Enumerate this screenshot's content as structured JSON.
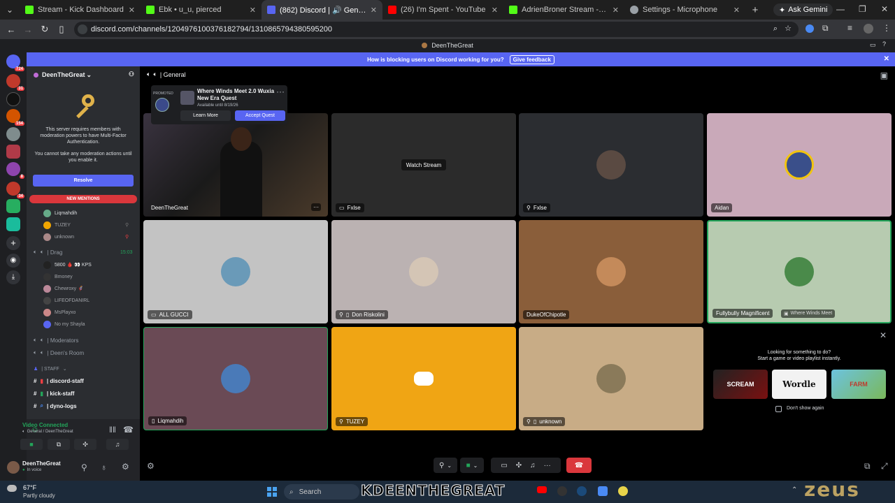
{
  "chrome": {
    "tabs": [
      {
        "label": "Stream - Kick Dashboard",
        "color": "#53fc18"
      },
      {
        "label": "Ebk • u_u, pierced",
        "color": "#53fc18"
      },
      {
        "label": "(862) Discord | 🔊 General",
        "color": "#5865f2",
        "active": true
      },
      {
        "label": "(26) I'm Spent - YouTube",
        "color": "#ff0000"
      },
      {
        "label": "AdrienBroner Stream - Watch L",
        "color": "#53fc18"
      },
      {
        "label": "Settings - Microphone",
        "color": "#9aa0a6"
      }
    ],
    "ask_gemini": "Ask Gemini",
    "url": "discord.com/channels/1204976100376182794/1310865794380595200"
  },
  "discord": {
    "window_title": "DeenTheGreat",
    "notice_text": "How is blocking users on Discord working for you?",
    "feedback_label": "Give feedback",
    "server_name": "DeenTheGreat",
    "mfa_line1": "This server requires members with moderation powers to have Multi-Factor Authentication.",
    "mfa_line2": "You cannot take any moderation actions until you enable it.",
    "resolve_label": "Resolve",
    "new_mentions": "NEW MENTIONS",
    "general_users": [
      "Liqmahdih",
      "TUZEY",
      "unknown"
    ],
    "drag_channel": "| Drag",
    "drag_time": "15:03",
    "drag_users": [
      "5800 🩸 👀 KPS",
      "Bmoney",
      "Chewroxy 🦸",
      "LIFEOFDANIRL",
      "MsPlayxo",
      "No my Shayla"
    ],
    "channels": [
      "| Moderators",
      "| Deen's Room"
    ],
    "staff_category": "| STAFF",
    "text_channels": [
      "| discord-staff",
      "| kick-staff",
      "| dyno-logs"
    ],
    "voice_status": "Video Connected",
    "voice_location": "General / DeenTheGreat",
    "username": "DeenTheGreat",
    "user_status": "In voice",
    "channel_header": "| General",
    "quest": {
      "promoted": "PROMOTED",
      "title": "Where Winds Meet 2.0 Wuxia New Era Quest",
      "available": "Available until 8/19/26",
      "learn_more": "Learn More",
      "accept": "Accept Quest"
    },
    "tiles": [
      {
        "name": "DeenTheGreat"
      },
      {
        "name": "Fxlse",
        "overlay": "Watch Stream"
      },
      {
        "name": "Fxlse"
      },
      {
        "name": "Aidan"
      },
      {
        "name": "ALL GUCCI"
      },
      {
        "name": "Don Riskolini"
      },
      {
        "name": "DukeOfChipotle"
      },
      {
        "name": "Fullybully Magnificent",
        "extra": "Where Winds Meet"
      },
      {
        "name": "Liqmahdih"
      },
      {
        "name": "TUZEY"
      },
      {
        "name": "unknown"
      }
    ],
    "suggest_title": "Looking for something to do?",
    "suggest_sub": "Start a game or video playlist instantly.",
    "suggest_items": [
      "SCREAM",
      "Wordle",
      "FARM"
    ],
    "dont_show": "Don't show again"
  },
  "taskbar": {
    "weather_temp": "67°F",
    "weather_desc": "Partly cloudy",
    "search_placeholder": "Search",
    "overlay_text": "KDEENTHEGREAT",
    "brand": "ZEUS"
  }
}
